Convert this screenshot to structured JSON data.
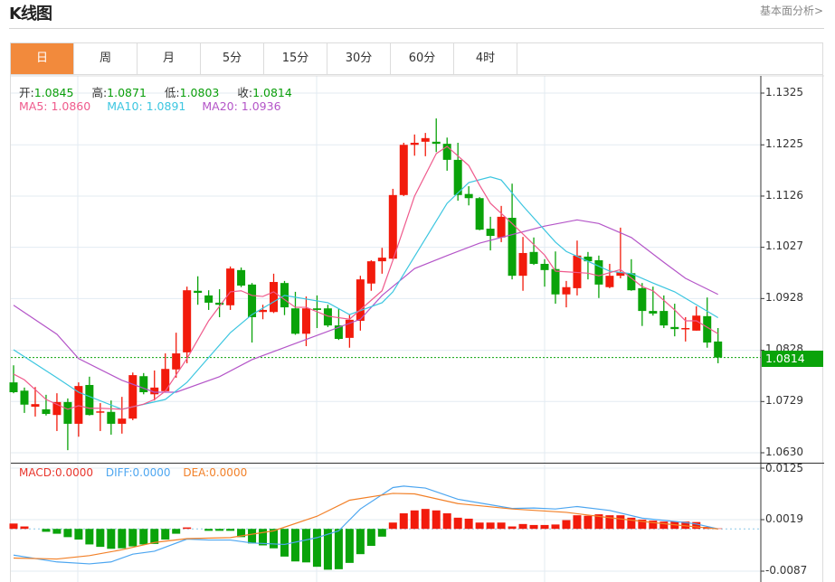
{
  "header": {
    "title": "K线图",
    "link": "基本面分析>"
  },
  "tabs": [
    {
      "label": "日",
      "active": true
    },
    {
      "label": "周"
    },
    {
      "label": "月"
    },
    {
      "label": "5分"
    },
    {
      "label": "15分"
    },
    {
      "label": "30分"
    },
    {
      "label": "60分"
    },
    {
      "label": "4时"
    }
  ],
  "ohlc": {
    "open_label": "开:",
    "open": "1.0845",
    "high_label": "高:",
    "high": "1.0871",
    "low_label": "低:",
    "low": "1.0803",
    "close_label": "收:",
    "close": "1.0814"
  },
  "ma_legend": {
    "ma5": "MA5: 1.0860",
    "ma10": "MA10: 1.0891",
    "ma20": "MA20: 1.0936"
  },
  "macd_legend": {
    "macd": "MACD:0.0000",
    "diff": "DIFF:0.0000",
    "dea": "DEA:0.0000"
  },
  "colors": {
    "up": "#f21b0c",
    "down": "#0aa30a",
    "ma5": "#ef5a8c",
    "ma10": "#3cc6e0",
    "ma20": "#b455c8",
    "diff": "#4da6f0",
    "dea": "#f28028",
    "active_tab": "#f28a3c",
    "macd_label": "#e8352c"
  },
  "chart_data": [
    {
      "type": "candlestick",
      "y_ticks": [
        "1.1325",
        "1.1225",
        "1.1126",
        "1.1027",
        "1.0928",
        "1.0828",
        "1.0729",
        "1.0630"
      ],
      "ylim": [
        1.063,
        1.1325
      ],
      "last_price": "1.0814",
      "candles": [
        [
          1.0766,
          1.0799,
          1.0745,
          1.0747
        ],
        [
          1.075,
          1.0756,
          1.0707,
          1.0723
        ],
        [
          1.0719,
          1.0757,
          1.07,
          1.0724
        ],
        [
          1.0714,
          1.0742,
          1.0702,
          1.0705
        ],
        [
          1.0703,
          1.0745,
          1.0672,
          1.0728
        ],
        [
          1.0728,
          1.0735,
          1.0635,
          1.0686
        ],
        [
          1.0686,
          1.0766,
          1.0661,
          1.0759
        ],
        [
          1.0761,
          1.0777,
          1.0702,
          1.0703
        ],
        [
          1.0709,
          1.0726,
          1.0672,
          1.071
        ],
        [
          1.0709,
          1.0731,
          1.0665,
          1.0686
        ],
        [
          1.0686,
          1.0738,
          1.0667,
          1.0696
        ],
        [
          1.0696,
          1.0785,
          1.0693,
          1.078
        ],
        [
          1.0778,
          1.0784,
          1.0743,
          1.0747
        ],
        [
          1.0743,
          1.0789,
          1.0731,
          1.0756
        ],
        [
          1.0749,
          1.0822,
          1.0747,
          1.0792
        ],
        [
          1.0791,
          1.0862,
          1.0775,
          1.0822
        ],
        [
          1.0824,
          1.0951,
          1.0803,
          1.0944
        ],
        [
          1.0943,
          1.0971,
          1.0916,
          1.0939
        ],
        [
          1.0934,
          1.0944,
          1.0906,
          1.092
        ],
        [
          1.092,
          1.0946,
          1.0892,
          1.0916
        ],
        [
          1.0915,
          1.099,
          1.0906,
          1.0986
        ],
        [
          1.0983,
          1.0988,
          1.095,
          1.0953
        ],
        [
          1.0955,
          1.0958,
          1.0843,
          1.0892
        ],
        [
          1.0902,
          1.0916,
          1.0888,
          1.0906
        ],
        [
          1.0902,
          1.0976,
          1.09,
          1.096
        ],
        [
          1.0958,
          1.0962,
          1.0896,
          1.0911
        ],
        [
          1.0909,
          1.0941,
          1.0858,
          1.086
        ],
        [
          1.086,
          1.0932,
          1.0836,
          1.0909
        ],
        [
          1.0909,
          1.0934,
          1.0871,
          1.0906
        ],
        [
          1.0909,
          1.0916,
          1.0873,
          1.0876
        ],
        [
          1.0876,
          1.0908,
          1.0848,
          1.085
        ],
        [
          1.0852,
          1.0897,
          1.0833,
          1.0887
        ],
        [
          1.0885,
          1.0972,
          1.0866,
          1.0965
        ],
        [
          1.0957,
          1.1002,
          1.0943,
          1.1
        ],
        [
          1.1,
          1.1026,
          1.0976,
          1.1007
        ],
        [
          1.1005,
          1.114,
          1.1004,
          1.1128
        ],
        [
          1.1128,
          1.1229,
          1.1126,
          1.1225
        ],
        [
          1.1225,
          1.1245,
          1.1204,
          1.1229
        ],
        [
          1.1231,
          1.1248,
          1.1203,
          1.1238
        ],
        [
          1.1231,
          1.1276,
          1.1211,
          1.1227
        ],
        [
          1.1227,
          1.1239,
          1.1175,
          1.1196
        ],
        [
          1.1196,
          1.1229,
          1.1117,
          1.1128
        ],
        [
          1.113,
          1.1145,
          1.1108,
          1.1122
        ],
        [
          1.1122,
          1.1124,
          1.106,
          1.1061
        ],
        [
          1.1063,
          1.1086,
          1.1021,
          1.1049
        ],
        [
          1.1046,
          1.1107,
          1.1037,
          1.1086
        ],
        [
          1.1084,
          1.115,
          1.0965,
          1.0972
        ],
        [
          1.0972,
          1.1047,
          1.0943,
          1.1016
        ],
        [
          1.1018,
          1.1046,
          1.0993,
          1.0995
        ],
        [
          1.0995,
          1.1004,
          1.0951,
          1.0983
        ],
        [
          1.0985,
          1.1019,
          1.0918,
          1.0936
        ],
        [
          1.0936,
          1.0962,
          1.0911,
          1.095
        ],
        [
          1.0948,
          1.104,
          1.0934,
          1.1011
        ],
        [
          1.1009,
          1.1018,
          1.0965,
          1.1
        ],
        [
          1.1002,
          1.1011,
          1.0929,
          1.0955
        ],
        [
          1.095,
          1.0995,
          1.0948,
          1.0972
        ],
        [
          1.0972,
          1.1065,
          1.0967,
          1.0979
        ],
        [
          1.0977,
          1.1004,
          1.0943,
          1.0944
        ],
        [
          1.0948,
          1.0958,
          1.0875,
          1.0904
        ],
        [
          1.0904,
          1.0951,
          1.0895,
          1.0899
        ],
        [
          1.0904,
          1.0934,
          1.0871,
          1.0876
        ],
        [
          1.0873,
          1.0918,
          1.0855,
          1.0869
        ],
        [
          1.0869,
          1.0892,
          1.0845,
          1.0871
        ],
        [
          1.0866,
          1.0913,
          1.0866,
          1.0895
        ],
        [
          1.0894,
          1.093,
          1.0833,
          1.0843
        ],
        [
          1.0845,
          1.0871,
          1.0803,
          1.0814
        ]
      ],
      "ma5": [
        [
          1,
          1.0782
        ],
        [
          2,
          1.0771
        ],
        [
          4,
          1.0733
        ],
        [
          6,
          1.0714
        ],
        [
          7,
          1.0721
        ],
        [
          8,
          1.0716
        ],
        [
          9,
          1.0716
        ],
        [
          11,
          1.0714
        ],
        [
          13,
          1.0724
        ],
        [
          14,
          1.0733
        ],
        [
          15,
          1.0749
        ],
        [
          17,
          1.0812
        ],
        [
          19,
          1.0885
        ],
        [
          21,
          1.0941
        ],
        [
          22,
          1.0943
        ],
        [
          23,
          1.0934
        ],
        [
          24,
          1.0932
        ],
        [
          25,
          1.0941
        ],
        [
          27,
          1.0911
        ],
        [
          28,
          1.0911
        ],
        [
          30,
          1.0894
        ],
        [
          32,
          1.0888
        ],
        [
          35,
          1.0943
        ],
        [
          36,
          1.1002
        ],
        [
          38,
          1.1126
        ],
        [
          40,
          1.1208
        ],
        [
          41,
          1.1222
        ],
        [
          43,
          1.1185
        ],
        [
          44,
          1.1147
        ],
        [
          45,
          1.1112
        ],
        [
          47,
          1.1073
        ],
        [
          50,
          1.1012
        ],
        [
          51,
          1.0981
        ],
        [
          54,
          1.0977
        ],
        [
          55,
          1.0972
        ],
        [
          57,
          1.0984
        ],
        [
          59,
          1.0951
        ],
        [
          60,
          1.0943
        ],
        [
          62,
          1.0906
        ],
        [
          63,
          1.0885
        ],
        [
          64,
          1.0885
        ],
        [
          66,
          1.086
        ]
      ],
      "ma10": [
        [
          1,
          1.0829
        ],
        [
          5,
          1.0775
        ],
        [
          7,
          1.0747
        ],
        [
          11,
          1.0714
        ],
        [
          15,
          1.0733
        ],
        [
          17,
          1.0766
        ],
        [
          21,
          1.0862
        ],
        [
          23,
          1.0897
        ],
        [
          26,
          1.0934
        ],
        [
          30,
          1.092
        ],
        [
          32,
          1.0897
        ],
        [
          35,
          1.092
        ],
        [
          36,
          1.0941
        ],
        [
          41,
          1.1112
        ],
        [
          43,
          1.1152
        ],
        [
          45,
          1.1163
        ],
        [
          46,
          1.1157
        ],
        [
          48,
          1.1107
        ],
        [
          51,
          1.1037
        ],
        [
          52,
          1.1019
        ],
        [
          56,
          1.0981
        ],
        [
          58,
          1.0976
        ],
        [
          60,
          1.0958
        ],
        [
          62,
          1.0941
        ],
        [
          66,
          1.0891
        ]
      ],
      "ma20": [
        [
          1,
          1.0915
        ],
        [
          5,
          1.0859
        ],
        [
          7,
          1.0812
        ],
        [
          11,
          1.077
        ],
        [
          14,
          1.0747
        ],
        [
          16,
          1.0747
        ],
        [
          20,
          1.0777
        ],
        [
          23,
          1.081
        ],
        [
          33,
          1.0888
        ],
        [
          35,
          1.0934
        ],
        [
          38,
          1.0986
        ],
        [
          41,
          1.1011
        ],
        [
          44,
          1.1035
        ],
        [
          50,
          1.1068
        ],
        [
          53,
          1.108
        ],
        [
          55,
          1.1073
        ],
        [
          58,
          1.1046
        ],
        [
          61,
          1.0998
        ],
        [
          63,
          1.0967
        ],
        [
          66,
          1.0936
        ]
      ]
    },
    {
      "type": "bar+line",
      "y_ticks": [
        "0.0125",
        "0.0019",
        "-0.0087"
      ],
      "ylim": [
        -0.0087,
        0.0125
      ],
      "macd": [
        0.0011,
        0.0005,
        0.0,
        -0.0006,
        -0.001,
        -0.0017,
        -0.0022,
        -0.0032,
        -0.0037,
        -0.0041,
        -0.004,
        -0.0036,
        -0.0032,
        -0.0031,
        -0.0022,
        -0.001,
        0.0003,
        0.0,
        -0.0004,
        -0.0004,
        -0.0004,
        -0.0017,
        -0.003,
        -0.0034,
        -0.004,
        -0.0057,
        -0.0067,
        -0.0069,
        -0.0078,
        -0.0084,
        -0.0083,
        -0.007,
        -0.0052,
        -0.0035,
        -0.0016,
        0.0013,
        0.0032,
        0.0038,
        0.0041,
        0.0038,
        0.0032,
        0.0023,
        0.0021,
        0.0013,
        0.0013,
        0.0013,
        0.0005,
        0.001,
        0.0008,
        0.0008,
        0.0009,
        0.0018,
        0.0028,
        0.0027,
        0.003,
        0.0028,
        0.0028,
        0.0023,
        0.0019,
        0.0017,
        0.0015,
        0.0015,
        0.0015,
        0.0014,
        0.0004,
        0.0001
      ],
      "diff": [
        [
          1,
          -0.0054
        ],
        [
          5,
          -0.0068
        ],
        [
          8,
          -0.0072
        ],
        [
          10,
          -0.0068
        ],
        [
          12,
          -0.0052
        ],
        [
          14,
          -0.0046
        ],
        [
          17,
          -0.0021
        ],
        [
          19,
          -0.0023
        ],
        [
          21,
          -0.0023
        ],
        [
          23,
          -0.0029
        ],
        [
          26,
          -0.0032
        ],
        [
          29,
          -0.0018
        ],
        [
          31,
          -0.0004
        ],
        [
          33,
          0.0041
        ],
        [
          36,
          0.0085
        ],
        [
          37,
          0.0088
        ],
        [
          39,
          0.0084
        ],
        [
          42,
          0.0061
        ],
        [
          47,
          0.0042
        ],
        [
          49,
          0.0043
        ],
        [
          51,
          0.0041
        ],
        [
          53,
          0.0046
        ],
        [
          56,
          0.0038
        ],
        [
          59,
          0.0022
        ],
        [
          63,
          0.0013
        ],
        [
          64,
          0.001
        ],
        [
          66,
          0.0
        ]
      ],
      "dea": [
        [
          1,
          -0.006
        ],
        [
          5,
          -0.0062
        ],
        [
          8,
          -0.0055
        ],
        [
          11,
          -0.0043
        ],
        [
          14,
          -0.0028
        ],
        [
          17,
          -0.002
        ],
        [
          21,
          -0.0018
        ],
        [
          25,
          -0.0004
        ],
        [
          29,
          0.0026
        ],
        [
          32,
          0.0059
        ],
        [
          36,
          0.0073
        ],
        [
          38,
          0.0072
        ],
        [
          42,
          0.0052
        ],
        [
          47,
          0.0041
        ],
        [
          52,
          0.0034
        ],
        [
          56,
          0.0023
        ],
        [
          60,
          0.0013
        ],
        [
          64,
          0.0004
        ],
        [
          66,
          0.0
        ]
      ]
    }
  ]
}
